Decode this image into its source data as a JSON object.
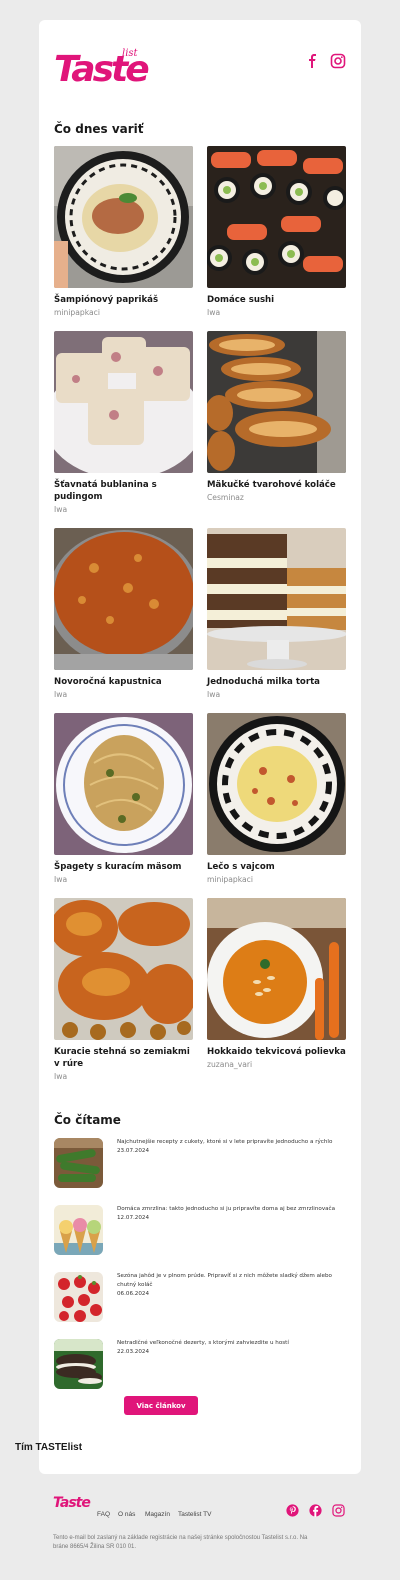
{
  "brand": {
    "logo_main": "Taste",
    "logo_sub": "list",
    "accent": "#e0157a"
  },
  "header": {
    "social": [
      "facebook-icon",
      "instagram-icon"
    ]
  },
  "section_today": "Čo dnes variť",
  "recipes": [
    {
      "title": "Šampiónový paprikáš",
      "author": "minipapkaci"
    },
    {
      "title": "Domáce sushi",
      "author": "Iwa"
    },
    {
      "title": "Šťavnatá bublanina s pudingom",
      "author": "Iwa"
    },
    {
      "title": "Mäkučké tvarohové koláče",
      "author": "Cesminaz"
    },
    {
      "title": "Novoročná kapustnica",
      "author": "Iwa"
    },
    {
      "title": "Jednoduchá milka torta",
      "author": "Iwa"
    },
    {
      "title": "Špagety s kuracím mäsom",
      "author": "Iwa"
    },
    {
      "title": "Lečo s vajcom",
      "author": "minipapkaci"
    },
    {
      "title": "Kuracie stehná so zemiakmi v rúre",
      "author": "Iwa"
    },
    {
      "title": "Hokkaido tekvicová polievka",
      "author": "zuzana_vari"
    }
  ],
  "section_read": "Čo čítame",
  "articles": [
    {
      "title": "Najchutnejšie recepty z cukety, ktoré si v lete pripravíte jednoducho a rýchlo",
      "date": "23.07.2024"
    },
    {
      "title": "Domáca zmrzlina: takto jednoducho si ju pripravíte doma aj bez zmrzlinovača",
      "date": "12.07.2024"
    },
    {
      "title": "Sezóna jahôd je v plnom prúde. Pripravíť si z nich môžete sladký džem alebo chutný koláč",
      "date": "06.06.2024"
    },
    {
      "title": "Netradičné veľkonočné dezerty, s ktorými zahviezdite u hostí",
      "date": "22.03.2024"
    }
  ],
  "more_button": "Viac článkov",
  "team": "Tím TASTElist",
  "footer": {
    "logo": "Taste",
    "nav": [
      "FAQ",
      "O nás",
      "Magazín",
      "Tastelist TV"
    ],
    "social": [
      "pinterest-icon",
      "facebook-icon",
      "instagram-icon"
    ],
    "fine": "Tento e-mail bol zaslaný na základe registrácie na našej stránke spoločnostou Tastelist s.r.o. Na bráne 8665/4 Žilina SR 010 01."
  }
}
